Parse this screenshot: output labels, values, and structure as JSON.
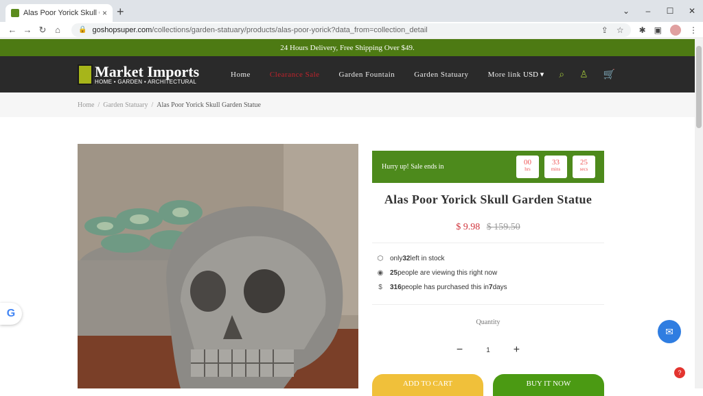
{
  "browser": {
    "tab_title": "Alas Poor Yorick Skull Garden Sta",
    "tab_close": "×",
    "new_tab": "+",
    "url_host": "goshopsuper.com",
    "url_path": "/collections/garden-statuary/products/alas-poor-yorick?data_from=collection_detail",
    "win_min": "⌄",
    "win_minimize": "–",
    "win_max": "☐",
    "win_close": "✕"
  },
  "announcement": "24 Hours Delivery, Free Shipping Over $49.",
  "logo": {
    "name": "Market Imports",
    "tagline": "HOME • GARDEN • ARCHITECTURAL"
  },
  "nav": {
    "items": [
      "Home",
      "Clearance Sale",
      "Garden Fountain",
      "Garden Statuary",
      "More link"
    ],
    "currency": "USD ▾"
  },
  "breadcrumb": {
    "home": "Home",
    "category": "Garden Statuary",
    "current": "Alas Poor Yorick Skull Garden Statue",
    "sep": "/"
  },
  "countdown": {
    "label": "Hurry up!  Sale ends in",
    "hrs": "00",
    "hrs_unit": "hrs",
    "mins": "33",
    "mins_unit": "mins",
    "secs": "25",
    "secs_unit": "secs"
  },
  "product": {
    "title": "Alas Poor Yorick Skull Garden Statue",
    "price": "$ 9.98",
    "compare_price": "$ 159.50",
    "stock_pre": "only ",
    "stock_count": "32",
    "stock_post": " left in stock",
    "viewing_count": "25",
    "viewing_text": " people are viewing this right now",
    "purchased_count": "316",
    "purchased_mid": " people has purchased this in ",
    "purchased_days": "7",
    "purchased_post": " days",
    "quantity_label": "Quantity",
    "quantity_value": "1",
    "minus": "−",
    "plus": "+",
    "add_to_cart": "ADD TO CART",
    "buy_now": "BUY IT NOW"
  },
  "colors": {
    "accent_green": "#4d7a13",
    "sale_red": "#c0232c",
    "icon_green": "#9fc23a"
  }
}
